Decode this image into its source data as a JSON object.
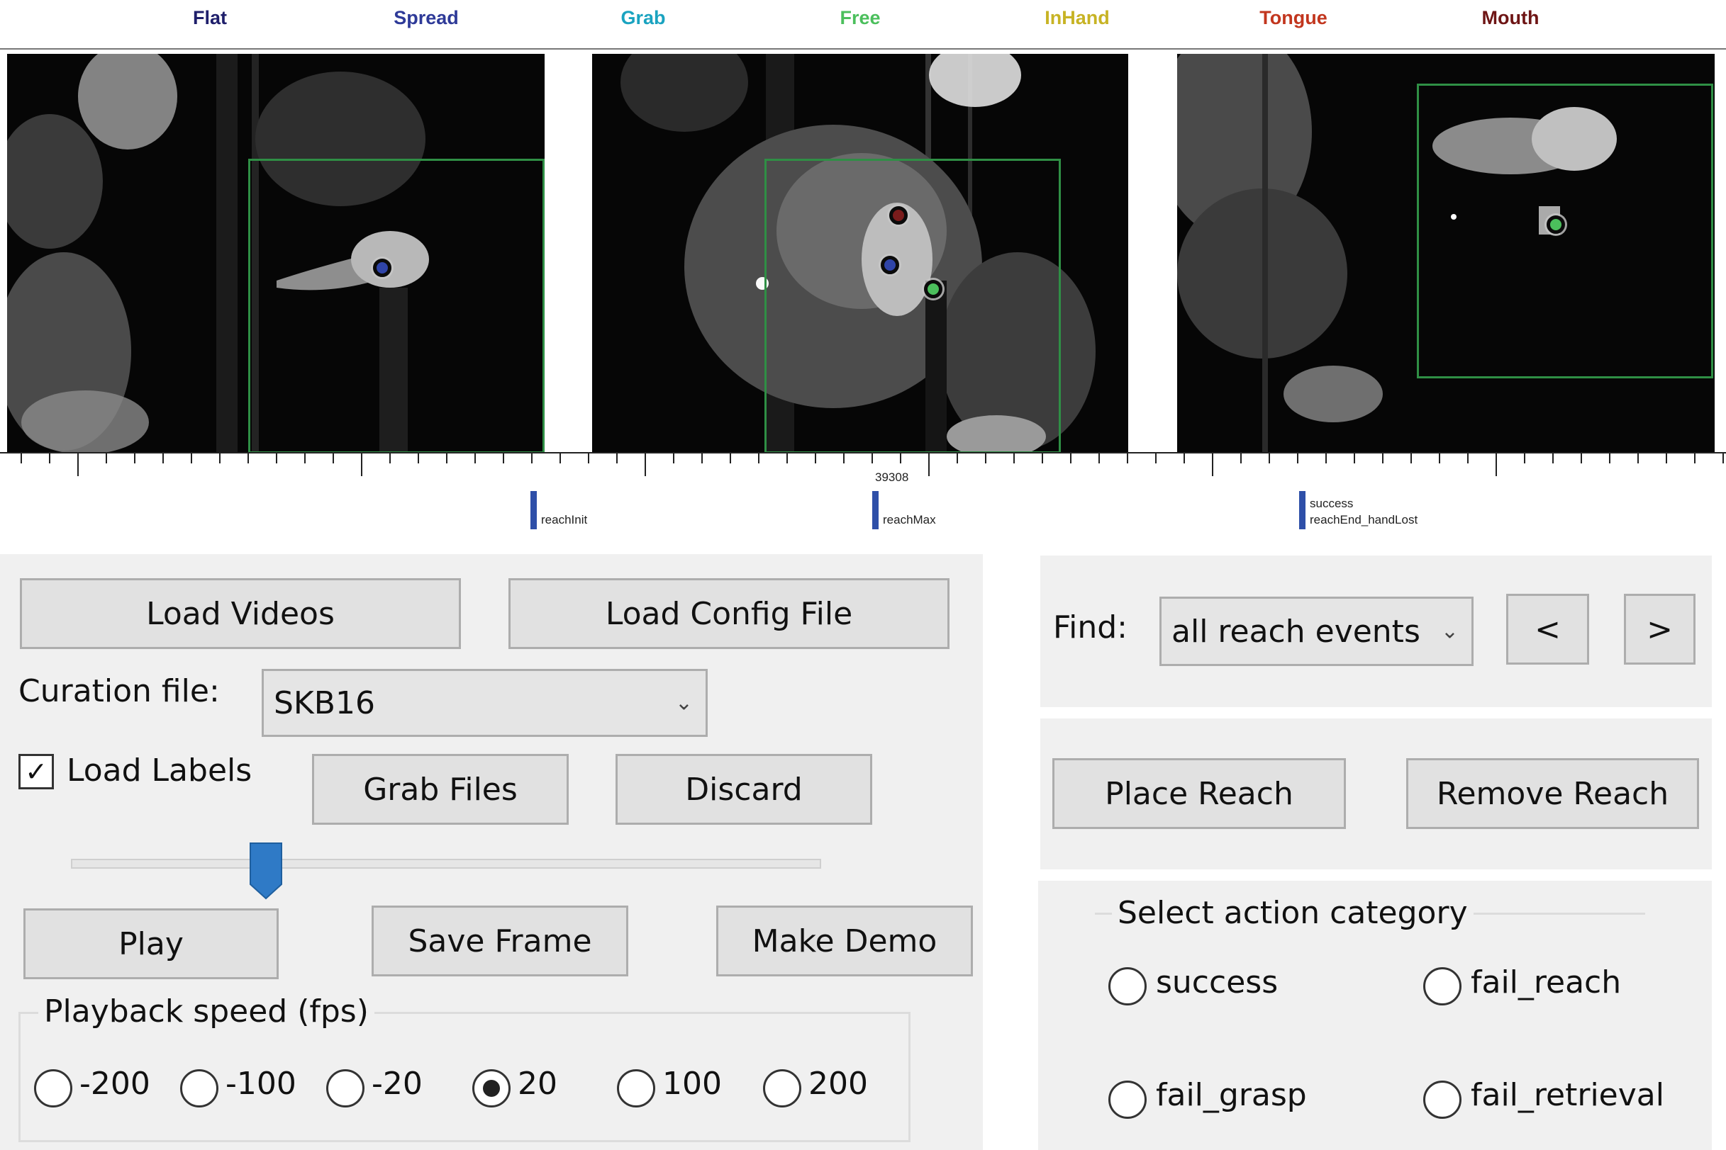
{
  "legend": [
    {
      "label": "Flat",
      "color": "#1f1f6b"
    },
    {
      "label": "Spread",
      "color": "#2e3a98"
    },
    {
      "label": "Grab",
      "color": "#1aa3c0"
    },
    {
      "label": "Free",
      "color": "#4bbf5c"
    },
    {
      "label": "InHand",
      "color": "#c7b324"
    },
    {
      "label": "Tongue",
      "color": "#c2361e"
    },
    {
      "label": "Mouth",
      "color": "#6e1515"
    }
  ],
  "timeline": {
    "frame_number": "39308",
    "events": [
      {
        "lines": [
          "reachInit"
        ]
      },
      {
        "lines": [
          "reachMax"
        ]
      },
      {
        "lines": [
          "success",
          "reachEnd_handLost"
        ]
      }
    ],
    "event_color": "#2e4fa8"
  },
  "controls": {
    "load_videos": "Load Videos",
    "load_config": "Load Config File",
    "curation_label": "Curation file:",
    "curation_value": "SKB16",
    "load_labels_label": "Load Labels",
    "load_labels_checked": true,
    "grab_files": "Grab Files",
    "discard": "Discard",
    "slider_value": 0.26,
    "play": "Play",
    "save_frame": "Save Frame",
    "make_demo": "Make Demo",
    "playback_title": "Playback speed (fps)",
    "speeds": [
      "-200",
      "-100",
      "-20",
      "20",
      "100",
      "200"
    ],
    "selected_speed": "20"
  },
  "right": {
    "find_label": "Find:",
    "find_value": "all reach events",
    "prev": "<",
    "next": ">",
    "place_reach": "Place Reach",
    "remove_reach": "Remove Reach",
    "category_title": "Select action category",
    "categories": [
      "success",
      "fail_reach",
      "fail_grasp",
      "fail_retrieval"
    ]
  },
  "accent": "#2f7ac6"
}
